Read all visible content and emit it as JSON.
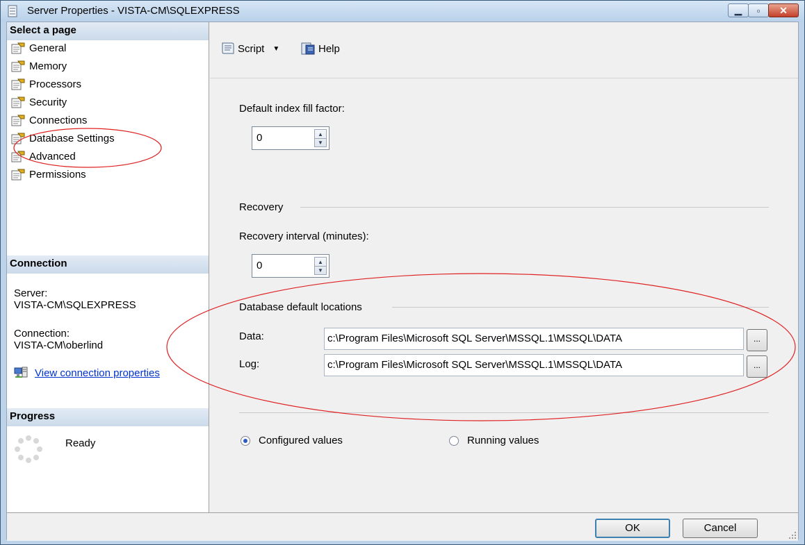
{
  "window": {
    "title": "Server Properties - VISTA-CM\\SQLEXPRESS"
  },
  "left": {
    "select_page_header": "Select a page",
    "pages": [
      "General",
      "Memory",
      "Processors",
      "Security",
      "Connections",
      "Database Settings",
      "Advanced",
      "Permissions"
    ],
    "connection_header": "Connection",
    "server_label": "Server:",
    "server_value": "VISTA-CM\\SQLEXPRESS",
    "connection_label": "Connection:",
    "connection_value": "VISTA-CM\\oberlind",
    "view_link": "View connection properties",
    "progress_header": "Progress",
    "progress_status": "Ready"
  },
  "toolbar": {
    "script_label": "Script",
    "help_label": "Help"
  },
  "main": {
    "fill_factor_label": "Default index fill factor:",
    "fill_factor_value": "0",
    "recovery_group": "Recovery",
    "recovery_interval_label": "Recovery interval (minutes):",
    "recovery_interval_value": "0",
    "locations_group": "Database default locations",
    "data_label": "Data:",
    "data_value": "c:\\Program Files\\Microsoft SQL Server\\MSSQL.1\\MSSQL\\DATA",
    "log_label": "Log:",
    "log_value": "c:\\Program Files\\Microsoft SQL Server\\MSSQL.1\\MSSQL\\DATA",
    "browse_label": "...",
    "configured_label": "Configured values",
    "running_label": "Running values"
  },
  "buttons": {
    "ok": "OK",
    "cancel": "Cancel"
  }
}
